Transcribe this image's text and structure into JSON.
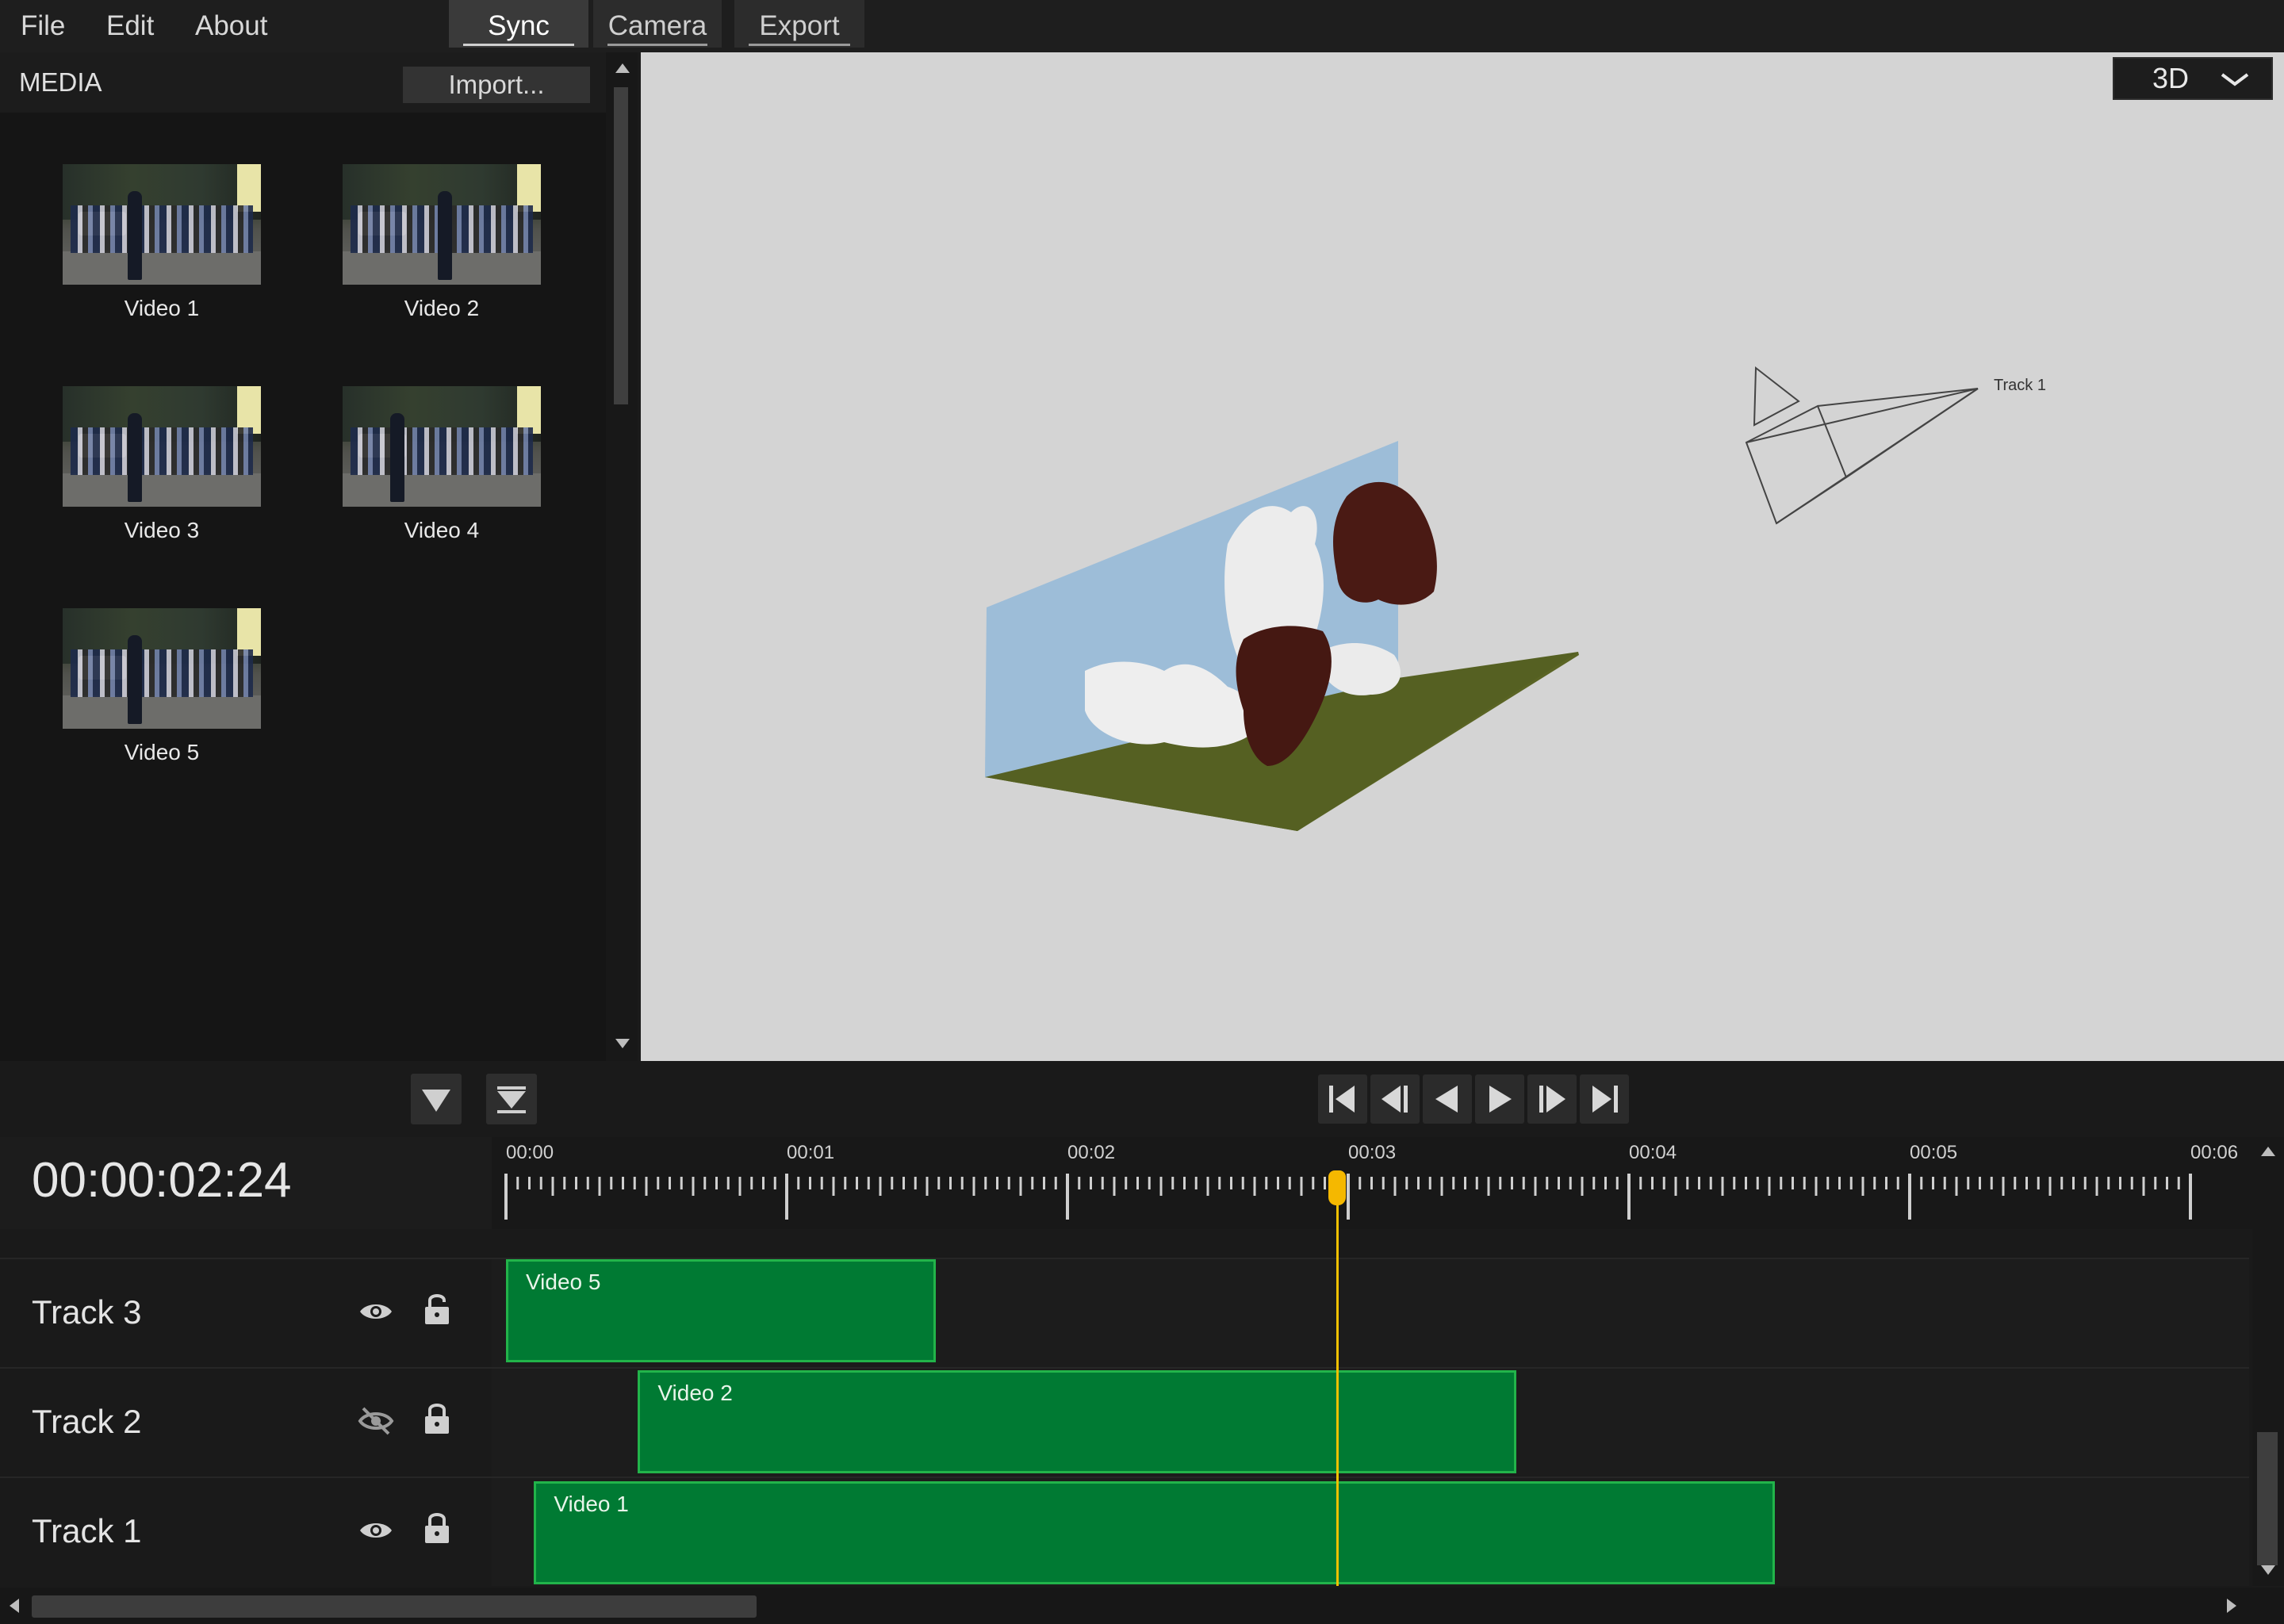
{
  "menu": {
    "file": "File",
    "edit": "Edit",
    "about": "About"
  },
  "modes": [
    {
      "label": "Sync",
      "active": true
    },
    {
      "label": "Camera",
      "active": false
    },
    {
      "label": "Export",
      "active": false
    }
  ],
  "media": {
    "title": "MEDIA",
    "import_label": "Import...",
    "items": [
      {
        "label": "Video 1"
      },
      {
        "label": "Video 2"
      },
      {
        "label": "Video 3"
      },
      {
        "label": "Video 4"
      },
      {
        "label": "Video 5"
      }
    ]
  },
  "viewport": {
    "view_mode": "3D",
    "camera_label": "Track 1",
    "background": "#d4d4d4"
  },
  "toolbar": {
    "left_icons": [
      "filter-down-icon",
      "collapse-all-icon"
    ],
    "playback_icons": [
      "skip-to-start-icon",
      "step-back-icon",
      "play-reverse-icon",
      "play-icon",
      "step-forward-icon",
      "skip-to-end-icon"
    ]
  },
  "timeline": {
    "timecode": "00:00:02:24",
    "ticks": [
      "00:00",
      "00:01",
      "00:02",
      "00:03",
      "00:04",
      "00:05",
      "00:06"
    ],
    "playhead_seconds": 2.96,
    "tracks": [
      {
        "name": "Track 3",
        "visible": true,
        "locked": false,
        "clip": {
          "label": "Video 5",
          "start": 0.0,
          "end": 1.53
        }
      },
      {
        "name": "Track 2",
        "visible": false,
        "locked": true,
        "clip": {
          "label": "Video 2",
          "start": 0.47,
          "end": 3.6
        }
      },
      {
        "name": "Track 1",
        "visible": true,
        "locked": true,
        "clip": {
          "label": "Video 1",
          "start": 0.1,
          "end": 4.52
        }
      }
    ],
    "clip_color": "#007a33",
    "playhead_color": "#f5b800"
  }
}
